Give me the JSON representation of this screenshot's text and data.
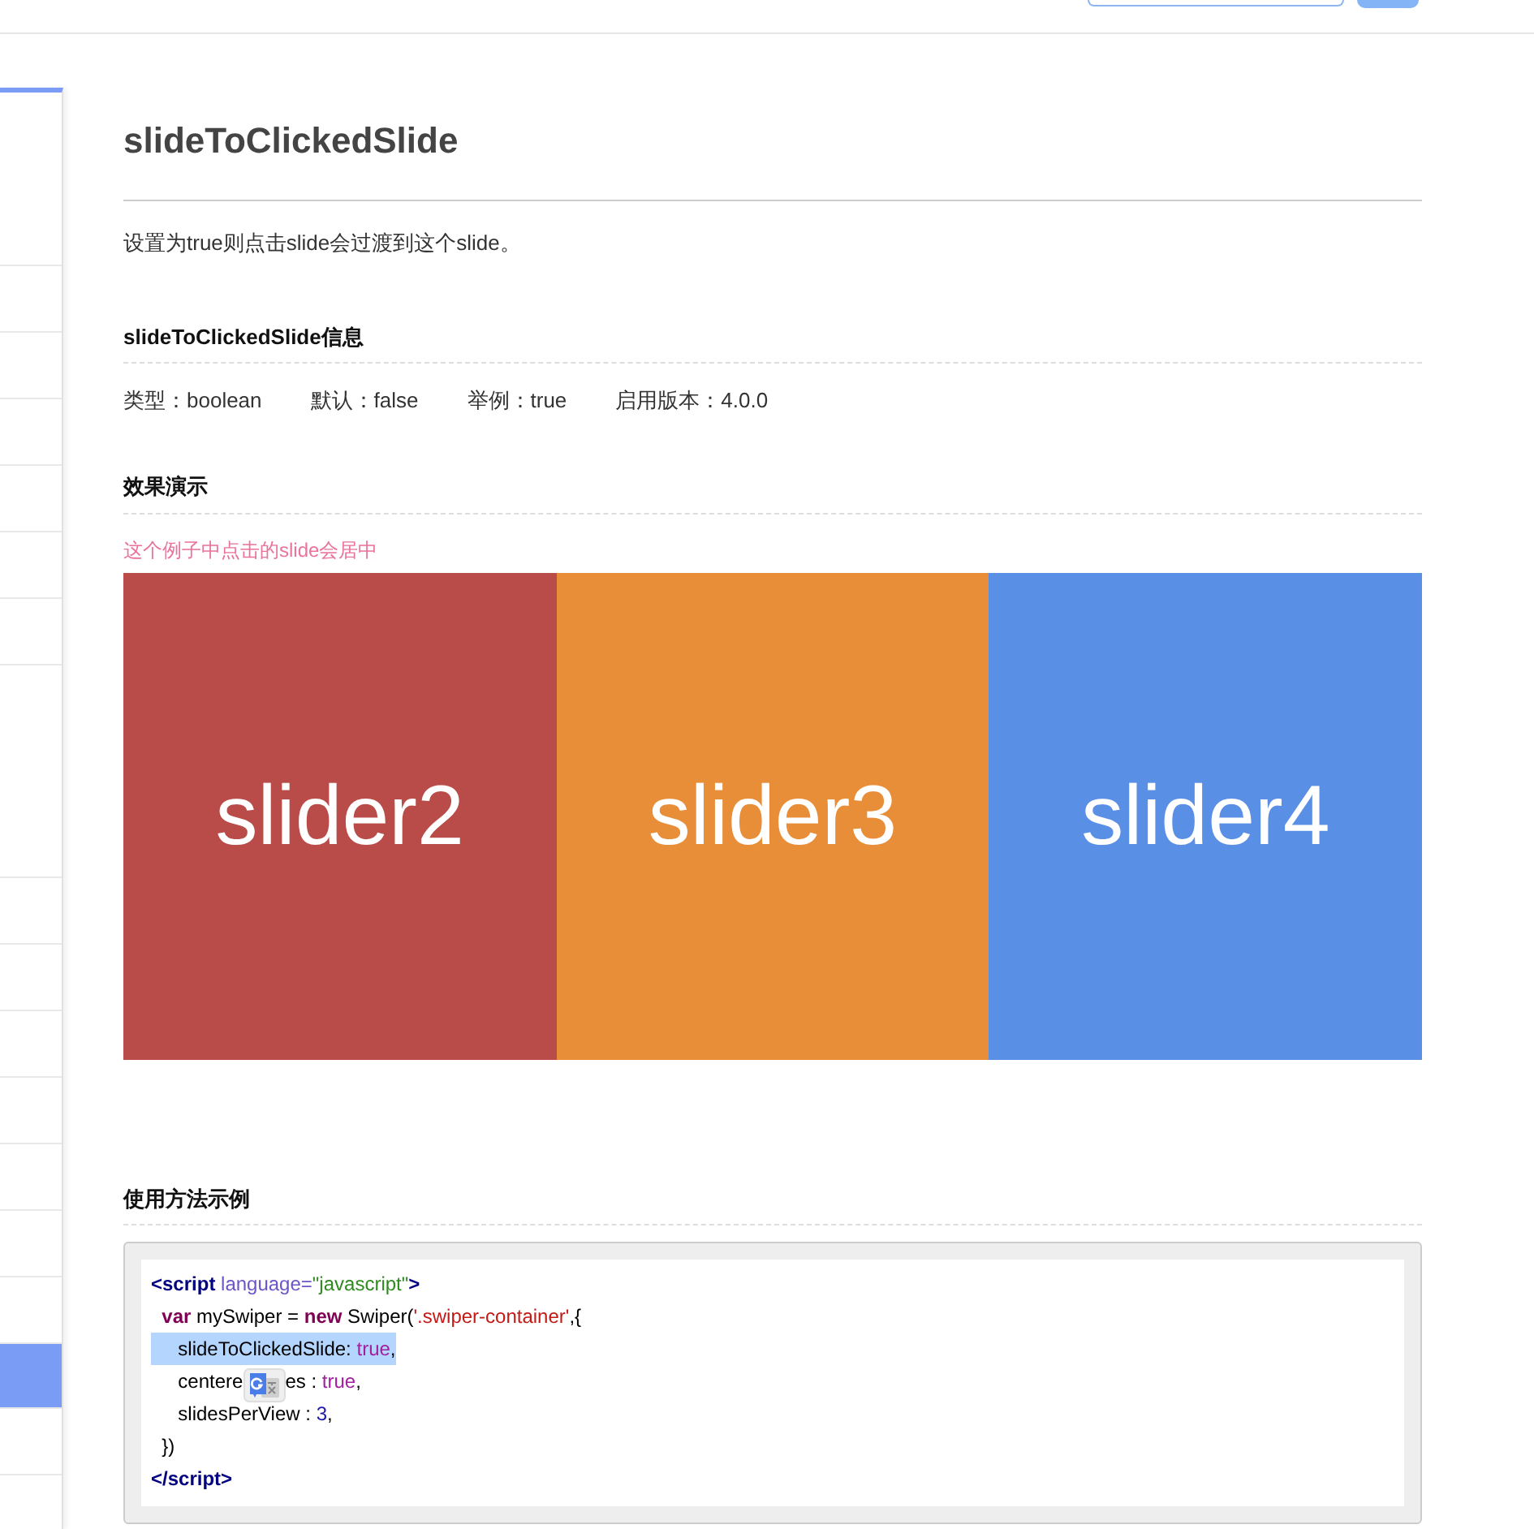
{
  "sidebar": {
    "items": [
      {
        "selected": false
      },
      {
        "selected": false
      },
      {
        "selected": false
      },
      {
        "selected": false
      },
      {
        "selected": false
      },
      {
        "selected": false
      },
      {
        "selected": false
      },
      {
        "selected": false
      },
      {
        "selected": false
      },
      {
        "selected": false
      },
      {
        "selected": false
      },
      {
        "selected": false
      },
      {
        "selected": false
      },
      {
        "selected": false
      },
      {
        "selected": false
      },
      {
        "selected": true
      },
      {
        "selected": false
      },
      {
        "selected": false
      }
    ]
  },
  "page": {
    "title": "slideToClickedSlide",
    "description": "设置为true则点击slide会过渡到这个slide。"
  },
  "info_section": {
    "heading": "slideToClickedSlide信息",
    "items": [
      "类型：boolean",
      "默认：false",
      "举例：true",
      "启用版本：4.0.0"
    ]
  },
  "demo_section": {
    "heading": "效果演示",
    "note": "这个例子中点击的slide会居中",
    "slides": [
      {
        "label": "slider2",
        "color": "#b94b48"
      },
      {
        "label": "slider3",
        "color": "#e88e38"
      },
      {
        "label": "slider4",
        "color": "#5a8fe6"
      }
    ]
  },
  "usage_section": {
    "heading": "使用方法示例",
    "code_lines": [
      {
        "selected": false,
        "tokens": [
          {
            "kind": "tag",
            "text": "<script"
          },
          {
            "kind": "attr",
            "text": " language="
          },
          {
            "kind": "attr_value",
            "text": "\"javascript\""
          },
          {
            "kind": "tag",
            "text": ">"
          }
        ]
      },
      {
        "selected": false,
        "tokens": [
          {
            "kind": "keyword",
            "text": "  var"
          },
          {
            "kind": "plain",
            "text": " mySwiper = "
          },
          {
            "kind": "keyword",
            "text": "new"
          },
          {
            "kind": "plain",
            "text": " Swiper("
          },
          {
            "kind": "string",
            "text": "'.swiper-container'"
          },
          {
            "kind": "plain",
            "text": ",{"
          }
        ]
      },
      {
        "selected": true,
        "tokens": [
          {
            "kind": "plain",
            "text": "     slideToClickedSlide: "
          },
          {
            "kind": "literal",
            "text": "true"
          },
          {
            "kind": "plain",
            "text": ","
          }
        ]
      },
      {
        "selected": false,
        "tokens": [
          {
            "kind": "plain",
            "text": "     centere"
          },
          {
            "kind": "translate_popup"
          },
          {
            "kind": "plain",
            "text": "es : "
          },
          {
            "kind": "literal",
            "text": "true"
          },
          {
            "kind": "plain",
            "text": ","
          }
        ]
      },
      {
        "selected": false,
        "tokens": [
          {
            "kind": "plain",
            "text": "     slidesPerView : "
          },
          {
            "kind": "number",
            "text": "3"
          },
          {
            "kind": "plain",
            "text": ","
          }
        ]
      },
      {
        "selected": false,
        "tokens": [
          {
            "kind": "plain",
            "text": "  })"
          }
        ]
      },
      {
        "selected": false,
        "tokens": [
          {
            "kind": "tag",
            "text": "</script>"
          }
        ]
      }
    ]
  }
}
